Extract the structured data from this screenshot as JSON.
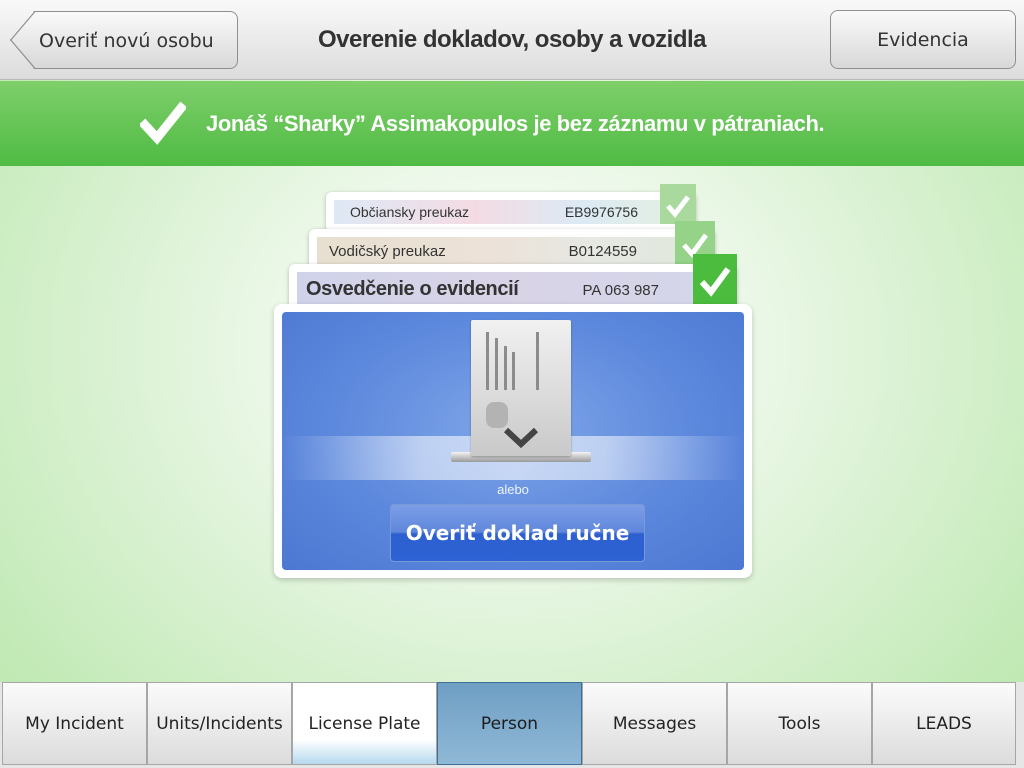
{
  "header": {
    "back_label": "Overiť novú osobu",
    "title": "Overenie dokladov, osoby a vozidla",
    "records_label": "Evidencia"
  },
  "banner": {
    "message": "Jonáš “Sharky” Assimakopulos je bez záznamu v pátraniach.",
    "color": "#4fbb44"
  },
  "documents": [
    {
      "label": "Občiansky preukaz",
      "number": "EB9976756",
      "verified": true
    },
    {
      "label": "Vodičský preukaz",
      "number": "B0124559",
      "verified": true
    },
    {
      "label": "Osvedčenie o evidencií",
      "number": "PA 063 987",
      "verified": true
    }
  ],
  "scanner": {
    "icon": "id-card-insert-icon",
    "or_label": "alebo",
    "manual_button_label": "Overiť doklad ručne"
  },
  "tabs": [
    {
      "label": "My Incident",
      "state": "normal"
    },
    {
      "label": "Units/Incidents",
      "state": "normal"
    },
    {
      "label": "License Plate",
      "state": "highlight"
    },
    {
      "label": "Person",
      "state": "active"
    },
    {
      "label": "Messages",
      "state": "normal"
    },
    {
      "label": "Tools",
      "state": "normal"
    },
    {
      "label": "LEADS",
      "state": "normal"
    }
  ]
}
